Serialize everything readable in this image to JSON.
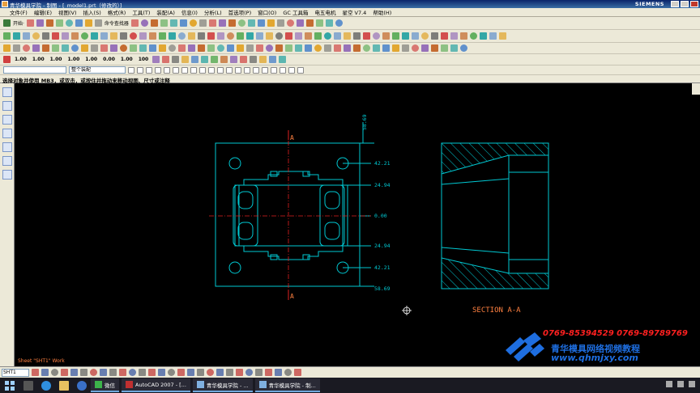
{
  "window": {
    "title": "青华模具学院 - 制图 - [_model1.prt（修改的）]",
    "brand": "SIEMENS"
  },
  "menu": [
    "文件(F)",
    "编辑(E)",
    "视图(V)",
    "插入(S)",
    "格式(R)",
    "工具(T)",
    "装配(A)",
    "信息(I)",
    "分析(L)",
    "首选项(P)",
    "窗口(O)",
    "GC 工具箱",
    "电五电机",
    "星空 V7.4",
    "帮助(H)"
  ],
  "toolbar": {
    "start_label": "开始·",
    "command_finder": "命令查找器",
    "dim_buttons": [
      "1.00",
      "1.00",
      "1.00",
      "1.00",
      "1.00",
      "0.00",
      "1.00",
      "100"
    ],
    "filter_value": "整个装配"
  },
  "cue_line": "选择对象并使用 MB3，或双击，或按住并拖动来移动视图、尺寸或注释",
  "drawing": {
    "section_marker": "A",
    "section_title": "SECTION A-A",
    "ordinate_dims": [
      "58.69",
      "42.21",
      "24.94",
      "0.00",
      "24.94",
      "42.21",
      "58.69"
    ],
    "sheet_label": "Sheet \"SHT1\" Work",
    "colors": {
      "geometry": "#00c8d2",
      "centerline": "#e02020",
      "section_text": "#ff8040",
      "hatch": "#00c8d2"
    }
  },
  "watermark": {
    "phones": "0769-85394529  0769-89789769",
    "name": "青华模具网络视频教程",
    "url": "www.qhmjxy.com"
  },
  "statusbar": {
    "sheet_select": "SHT1"
  },
  "taskbar": {
    "items": [
      "微信",
      "AutoCAD 2007 - [...",
      "青华模具学院 - ...",
      "青华模具学院 - 制..."
    ]
  }
}
